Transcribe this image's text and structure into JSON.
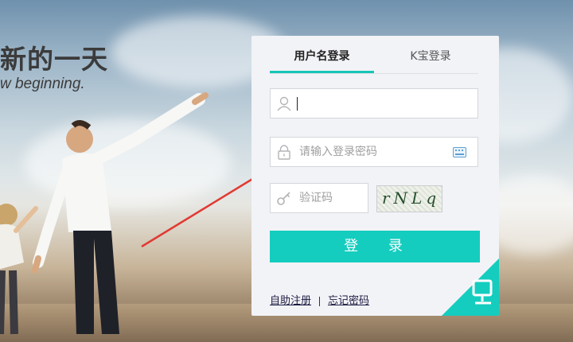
{
  "hero": {
    "slogan_cn": "新的一天",
    "slogan_en": "w beginning."
  },
  "login": {
    "tabs": [
      {
        "label": "用户名登录",
        "active": true
      },
      {
        "label": "K宝登录",
        "active": false
      }
    ],
    "username": {
      "value": "",
      "placeholder": "",
      "icon": "user-icon"
    },
    "password": {
      "value": "",
      "placeholder": "请输入登录密码",
      "icon": "lock-icon",
      "keyboard_icon": "keyboard-icon"
    },
    "captcha": {
      "value": "",
      "placeholder": "验证码",
      "icon": "key-icon",
      "image_text": "rNLq"
    },
    "submit_label": "登 录",
    "links": {
      "register": "自助注册",
      "forgot": "忘记密码"
    },
    "accent_color": "#14cdbf",
    "corner_icon": "monitor-qr-icon"
  }
}
